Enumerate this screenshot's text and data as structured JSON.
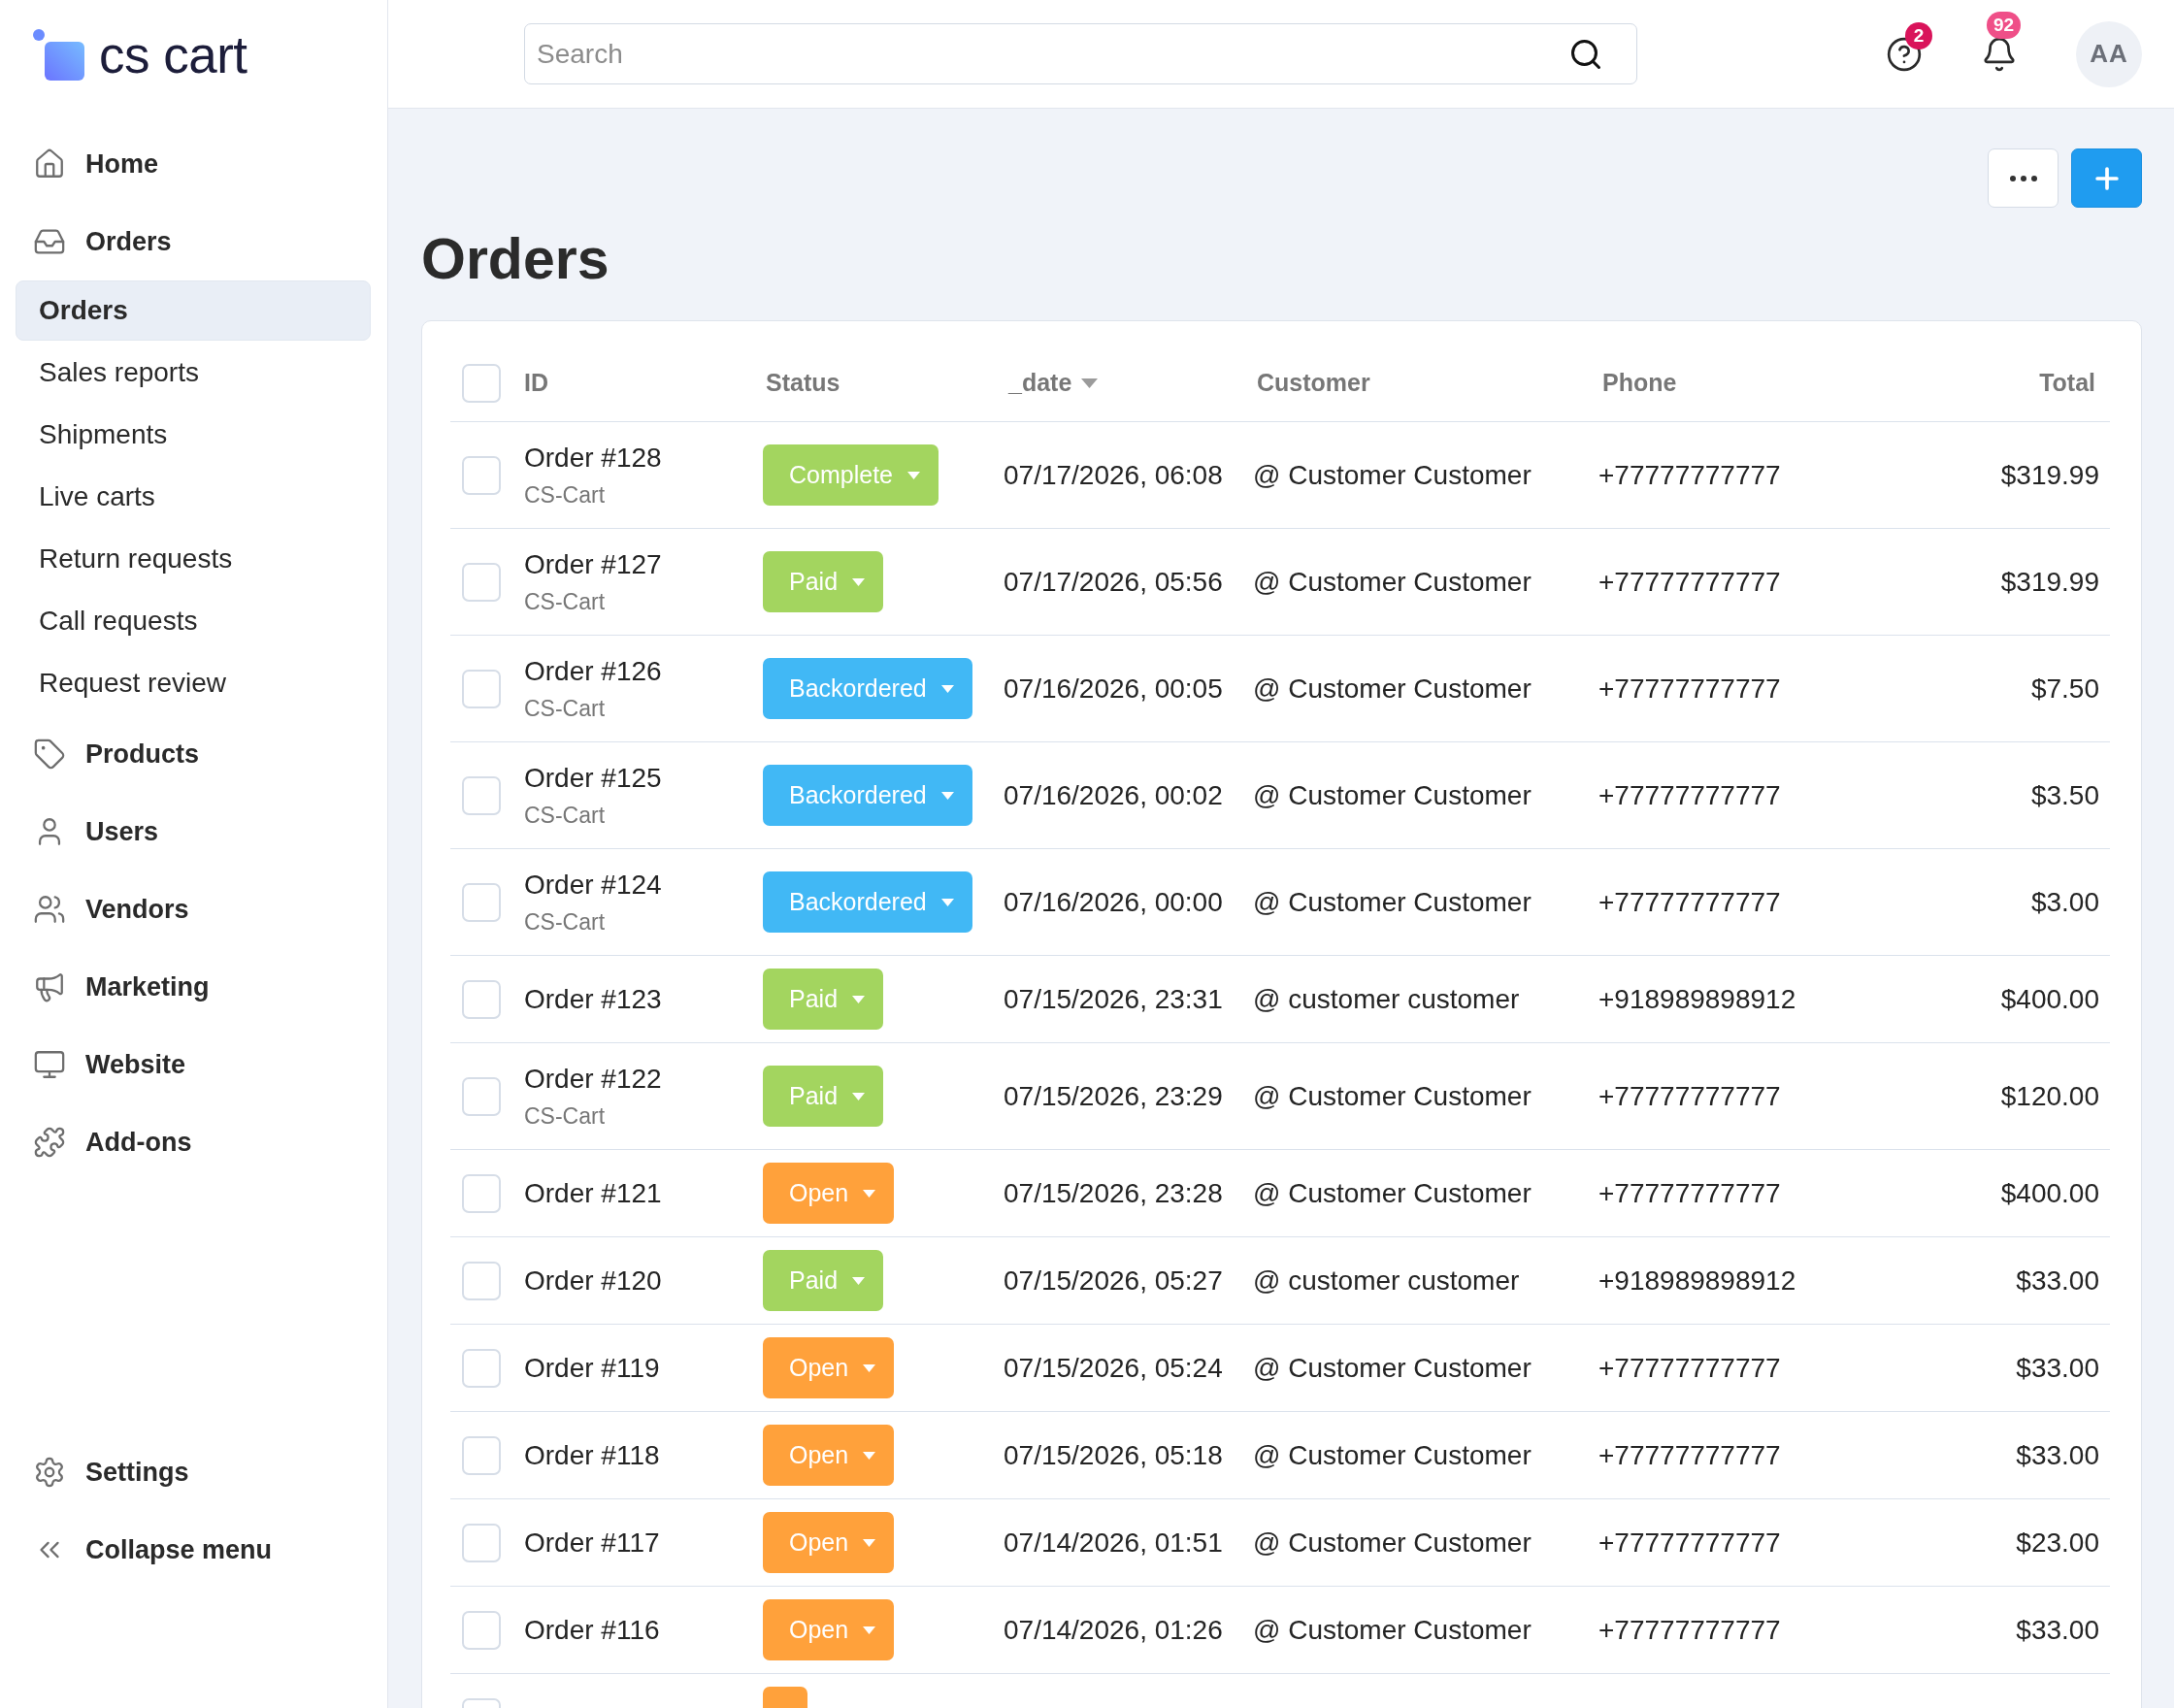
{
  "sidebar": {
    "logo": "cs cart",
    "items": [
      {
        "label": "Home",
        "selected": false
      },
      {
        "label": "Orders",
        "selected": false,
        "expanded": true,
        "children": [
          {
            "label": "Orders",
            "selected": true
          },
          {
            "label": "Sales reports",
            "selected": false
          },
          {
            "label": "Shipments",
            "selected": false
          },
          {
            "label": "Live carts",
            "selected": false
          },
          {
            "label": "Return requests",
            "selected": false
          },
          {
            "label": "Call requests",
            "selected": false
          },
          {
            "label": "Request review",
            "selected": false
          }
        ]
      },
      {
        "label": "Products",
        "selected": false
      },
      {
        "label": "Users",
        "selected": false
      },
      {
        "label": "Vendors",
        "selected": false
      },
      {
        "label": "Marketing",
        "selected": false
      },
      {
        "label": "Website",
        "selected": false
      },
      {
        "label": "Add-ons",
        "selected": false
      }
    ],
    "footer": [
      {
        "label": "Settings"
      },
      {
        "label": "Collapse menu"
      }
    ]
  },
  "header": {
    "search": {
      "placeholder": "Search"
    },
    "help_count": "2",
    "notification_count": "92",
    "avatar": "AA"
  },
  "page": {
    "title": "Orders"
  },
  "table": {
    "select_all": {
      "checked": false
    },
    "columns": [
      {
        "label": "ID",
        "sorted": false
      },
      {
        "label": "Status",
        "sorted": false
      },
      {
        "label": "_date",
        "sorted": true
      },
      {
        "label": "Customer",
        "sorted": false
      },
      {
        "label": "Phone",
        "sorted": false
      },
      {
        "label": "Total",
        "sorted": false
      }
    ],
    "rows": [
      {
        "checked": false,
        "id": "Order #128",
        "store": "CS-Cart",
        "status": {
          "label": "Complete",
          "color": "#a3d55f"
        },
        "date": "07/17/2026, 06:08",
        "customer": "@ Customer Customer",
        "phone": "+77777777777",
        "total": "$319.99"
      },
      {
        "checked": false,
        "id": "Order #127",
        "store": "CS-Cart",
        "status": {
          "label": "Paid",
          "color": "#a3d55f"
        },
        "date": "07/17/2026, 05:56",
        "customer": "@ Customer Customer",
        "phone": "+77777777777",
        "total": "$319.99"
      },
      {
        "checked": false,
        "id": "Order #126",
        "store": "CS-Cart",
        "status": {
          "label": "Backordered",
          "color": "#41b8f5"
        },
        "date": "07/16/2026, 00:05",
        "customer": "@ Customer Customer",
        "phone": "+77777777777",
        "total": "$7.50"
      },
      {
        "checked": false,
        "id": "Order #125",
        "store": "CS-Cart",
        "status": {
          "label": "Backordered",
          "color": "#41b8f5"
        },
        "date": "07/16/2026, 00:02",
        "customer": "@ Customer Customer",
        "phone": "+77777777777",
        "total": "$3.50"
      },
      {
        "checked": false,
        "id": "Order #124",
        "store": "CS-Cart",
        "status": {
          "label": "Backordered",
          "color": "#41b8f5"
        },
        "date": "07/16/2026, 00:00",
        "customer": "@ Customer Customer",
        "phone": "+77777777777",
        "total": "$3.00"
      },
      {
        "checked": false,
        "id": "Order #123",
        "status": {
          "label": "Paid",
          "color": "#a3d55f"
        },
        "date": "07/15/2026, 23:31",
        "customer": "@ customer customer",
        "phone": "+918989898912",
        "total": "$400.00"
      },
      {
        "checked": false,
        "id": "Order #122",
        "store": "CS-Cart",
        "status": {
          "label": "Paid",
          "color": "#a3d55f"
        },
        "date": "07/15/2026, 23:29",
        "customer": "@ Customer Customer",
        "phone": "+77777777777",
        "total": "$120.00"
      },
      {
        "checked": false,
        "id": "Order #121",
        "status": {
          "label": "Open",
          "color": "#ffa13b"
        },
        "date": "07/15/2026, 23:28",
        "customer": "@ Customer Customer",
        "phone": "+77777777777",
        "total": "$400.00"
      },
      {
        "checked": false,
        "id": "Order #120",
        "status": {
          "label": "Paid",
          "color": "#a3d55f"
        },
        "date": "07/15/2026, 05:27",
        "customer": "@ customer customer",
        "phone": "+918989898912",
        "total": "$33.00"
      },
      {
        "checked": false,
        "id": "Order #119",
        "status": {
          "label": "Open",
          "color": "#ffa13b"
        },
        "date": "07/15/2026, 05:24",
        "customer": "@ Customer Customer",
        "phone": "+77777777777",
        "total": "$33.00"
      },
      {
        "checked": false,
        "id": "Order #118",
        "status": {
          "label": "Open",
          "color": "#ffa13b"
        },
        "date": "07/15/2026, 05:18",
        "customer": "@ Customer Customer",
        "phone": "+77777777777",
        "total": "$33.00"
      },
      {
        "checked": false,
        "id": "Order #117",
        "status": {
          "label": "Open",
          "color": "#ffa13b"
        },
        "date": "07/14/2026, 01:51",
        "customer": "@ Customer Customer",
        "phone": "+77777777777",
        "total": "$23.00"
      },
      {
        "checked": false,
        "id": "Order #116",
        "status": {
          "label": "Open",
          "color": "#ffa13b"
        },
        "date": "07/14/2026, 01:26",
        "customer": "@ Customer Customer",
        "phone": "+77777777777",
        "total": "$33.00"
      },
      {
        "checked": false,
        "status": {
          "color": "#ffa13b"
        }
      }
    ]
  }
}
